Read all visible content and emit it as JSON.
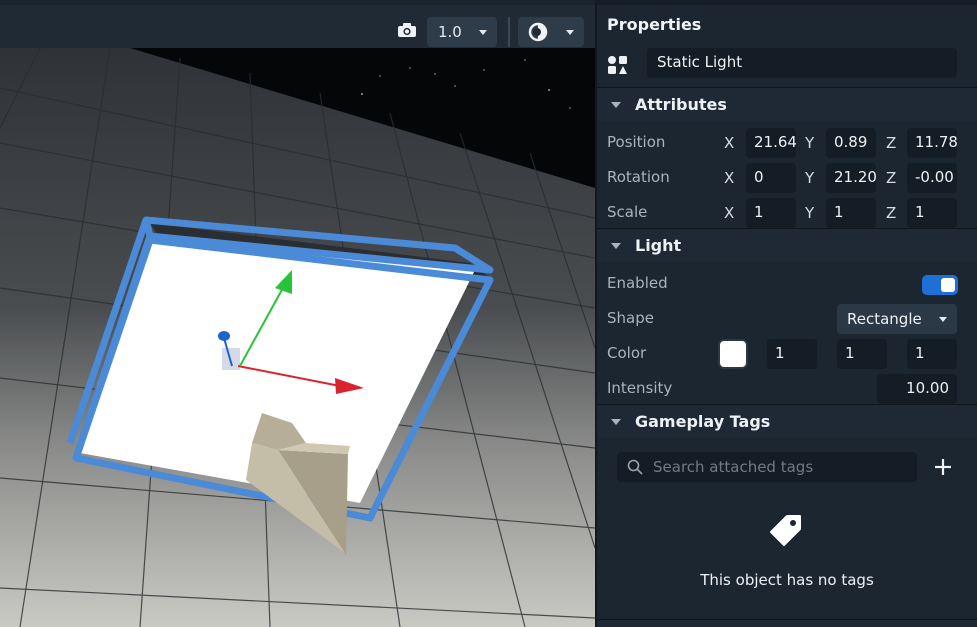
{
  "viewport": {
    "toolbar": {
      "camera_icon": "camera-icon",
      "scale_value": "1.0",
      "shading_icon": "shading-icon"
    }
  },
  "properties": {
    "title": "Properties",
    "object_type": "Static Light",
    "attributes": {
      "label": "Attributes",
      "position": {
        "label": "Position",
        "x_label": "X",
        "y_label": "Y",
        "z_label": "Z",
        "x": "21.64",
        "y": "0.89",
        "z": "11.78"
      },
      "rotation": {
        "label": "Rotation",
        "x_label": "X",
        "y_label": "Y",
        "z_label": "Z",
        "x": "0",
        "y": "21.20",
        "z": "-0.00"
      },
      "scale": {
        "label": "Scale",
        "x_label": "X",
        "y_label": "Y",
        "z_label": "Z",
        "x": "1",
        "y": "1",
        "z": "1"
      }
    },
    "light": {
      "label": "Light",
      "enabled_label": "Enabled",
      "enabled": true,
      "shape_label": "Shape",
      "shape_value": "Rectangle",
      "color_label": "Color",
      "color_hex": "#ffffff",
      "color_r": "1",
      "color_g": "1",
      "color_b": "1",
      "intensity_label": "Intensity",
      "intensity": "10.00"
    },
    "gameplay_tags": {
      "label": "Gameplay Tags",
      "search_placeholder": "Search attached tags",
      "empty_text": "This object has no tags"
    }
  },
  "colors": {
    "accent": "#1f6fd6",
    "selection": "#4a8ad6",
    "gizmo_x": "#d9232e",
    "gizmo_y": "#27c43a",
    "gizmo_z": "#1c63d0"
  }
}
